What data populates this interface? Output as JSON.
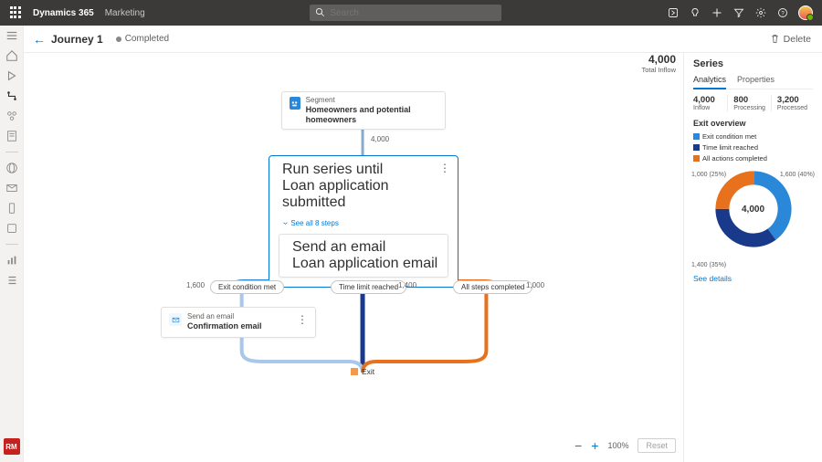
{
  "topbar": {
    "app": "Dynamics 365",
    "area": "Marketing",
    "search_placeholder": "Search"
  },
  "cmdbar": {
    "title": "Journey 1",
    "status": "Completed",
    "delete_label": "Delete"
  },
  "leftnav": {
    "persona": "RM"
  },
  "canvas": {
    "total_inflow": {
      "value": "4,000",
      "label": "Total Inflow"
    },
    "segment": {
      "sub": "Segment",
      "main": "Homeowners and potential homeowners"
    },
    "count_seg": "4,000",
    "series": {
      "sub": "Run series until",
      "main": "Loan application submitted",
      "expand": "See all 8 steps",
      "inner_sub": "Send an email",
      "inner_main": "Loan application email"
    },
    "chips": {
      "exit": "Exit condition met",
      "time": "Time limit reached",
      "steps": "All steps completed"
    },
    "counts": {
      "exit": "1,600",
      "time": "1,400",
      "steps": "1,000"
    },
    "confirm": {
      "sub": "Send an email",
      "main": "Confirmation email"
    },
    "exit_label": "Exit",
    "zoom": {
      "value": "100%",
      "reset": "Reset"
    }
  },
  "side": {
    "title": "Series",
    "tabs": {
      "analytics": "Analytics",
      "properties": "Properties"
    },
    "triplet": [
      {
        "v": "4,000",
        "l": "Inflow"
      },
      {
        "v": "800",
        "l": "Processing"
      },
      {
        "v": "3,200",
        "l": "Processed"
      }
    ],
    "overview_title": "Exit overview",
    "legend": {
      "exit": "Exit condition met",
      "time": "Time limit reached",
      "all": "All actions completed"
    },
    "donut": {
      "total": "4,000",
      "labels": {
        "tl": "1,000 (25%)",
        "tr": "1,600 (40%)",
        "bl": "1,400 (35%)"
      }
    },
    "see_details": "See details"
  },
  "chart_data": {
    "type": "pie",
    "title": "Exit overview",
    "series": [
      {
        "name": "Exit condition met",
        "value": 1600,
        "pct": 40,
        "color": "#2b88d8"
      },
      {
        "name": "Time limit reached",
        "value": 1400,
        "pct": 35,
        "color": "#193a8a"
      },
      {
        "name": "All actions completed",
        "value": 1000,
        "pct": 25,
        "color": "#e8711e"
      }
    ],
    "total": 4000
  },
  "colors": {
    "blue": "#2b88d8",
    "navy": "#193a8a",
    "orange": "#e8711e",
    "light": "#a9c7ea"
  }
}
